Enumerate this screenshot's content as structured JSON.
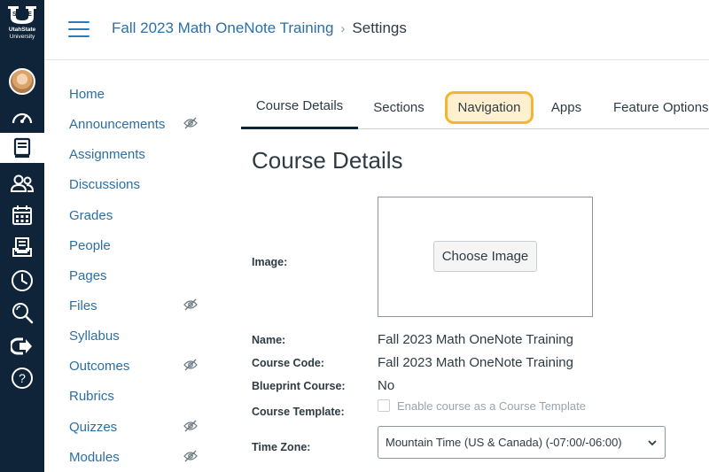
{
  "logo": {
    "line1": "STATE",
    "line2": "UtahState",
    "line3": "University"
  },
  "global_nav": {
    "items": [
      {
        "name": "account",
        "icon": "avatar-icon"
      },
      {
        "name": "dashboard",
        "icon": "dashboard-icon"
      },
      {
        "name": "courses",
        "icon": "courses-icon"
      },
      {
        "name": "groups",
        "icon": "groups-icon"
      },
      {
        "name": "calendar",
        "icon": "calendar-icon"
      },
      {
        "name": "inbox",
        "icon": "inbox-icon"
      },
      {
        "name": "history",
        "icon": "clock-icon"
      },
      {
        "name": "search",
        "icon": "search-icon"
      },
      {
        "name": "commons",
        "icon": "commons-icon"
      },
      {
        "name": "help",
        "icon": "help-icon"
      }
    ],
    "bg_color": "#0f2439"
  },
  "header": {
    "course_link": "Fall 2023 Math OneNote Training",
    "separator": "›",
    "current": "Settings"
  },
  "course_nav": {
    "items": [
      {
        "label": "Home",
        "hidden": false
      },
      {
        "label": "Announcements",
        "hidden": true
      },
      {
        "label": "Assignments",
        "hidden": false
      },
      {
        "label": "Discussions",
        "hidden": false
      },
      {
        "label": "Grades",
        "hidden": false
      },
      {
        "label": "People",
        "hidden": false
      },
      {
        "label": "Pages",
        "hidden": false
      },
      {
        "label": "Files",
        "hidden": true
      },
      {
        "label": "Syllabus",
        "hidden": false
      },
      {
        "label": "Outcomes",
        "hidden": true
      },
      {
        "label": "Rubrics",
        "hidden": false
      },
      {
        "label": "Quizzes",
        "hidden": true
      },
      {
        "label": "Modules",
        "hidden": true
      }
    ]
  },
  "tabs": [
    {
      "label": "Course Details",
      "active": true
    },
    {
      "label": "Sections",
      "active": false
    },
    {
      "label": "Navigation",
      "active": false,
      "highlighted": true
    },
    {
      "label": "Apps",
      "active": false
    },
    {
      "label": "Feature Options",
      "active": false
    }
  ],
  "main": {
    "title": "Course Details",
    "image_label": "Image:",
    "choose_image": "Choose Image",
    "name_label": "Name:",
    "name_value": "Fall 2023 Math OneNote Training",
    "code_label": "Course Code:",
    "code_value": "Fall 2023 Math OneNote Training",
    "blueprint_label": "Blueprint Course:",
    "blueprint_value": "No",
    "template_label": "Course Template:",
    "template_checkbox": "Enable course as a Course Template",
    "timezone_label": "Time Zone:",
    "timezone_value": "Mountain Time (US & Canada) (-07:00/-06:00)"
  },
  "colors": {
    "link": "#2b6fa5",
    "highlight_border": "#f2b632",
    "highlight_bg": "#fff1d0"
  }
}
